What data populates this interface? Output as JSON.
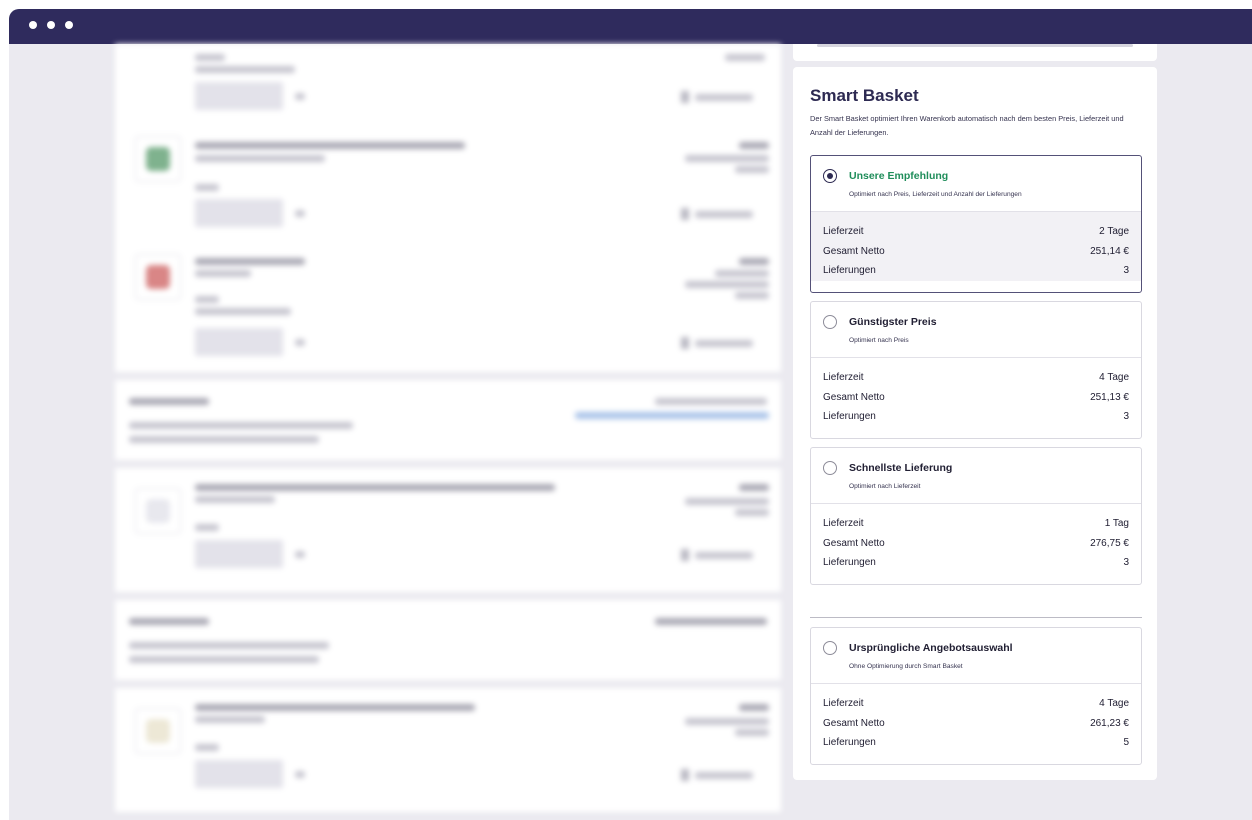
{
  "window": {
    "controls": [
      "dot",
      "dot",
      "dot"
    ]
  },
  "smart_basket": {
    "title": "Smart Basket",
    "description": "Der Smart Basket optimiert Ihren Warenkorb automatisch nach dem besten Preis, Lieferzeit und Anzahl der Lieferungen.",
    "labels": {
      "delivery_time": "Lieferzeit",
      "total_net": "Gesamt Netto",
      "deliveries": "Lieferungen"
    },
    "options": [
      {
        "name": "Unsere Empfehlung",
        "subtitle": "Optimiert nach Preis, Lieferzeit und Anzahl der Lieferungen",
        "delivery_time": "2 Tage",
        "total_net": "251,14 €",
        "deliveries": "3",
        "selected": true
      },
      {
        "name": "Günstigster Preis",
        "subtitle": "Optimiert nach Preis",
        "delivery_time": "4 Tage",
        "total_net": "251,13 €",
        "deliveries": "3",
        "selected": false
      },
      {
        "name": "Schnellste Lieferung",
        "subtitle": "Optimiert nach Lieferzeit",
        "delivery_time": "1 Tag",
        "total_net": "276,75 €",
        "deliveries": "3",
        "selected": false
      },
      {
        "name": "Ursprüngliche Angebotsauswahl",
        "subtitle": "Ohne Optimierung durch Smart Basket",
        "delivery_time": "4 Tage",
        "total_net": "261,23 €",
        "deliveries": "5",
        "selected": false
      }
    ]
  },
  "colors": {
    "titlebar": "#2f2b5d",
    "accent": "#2d2a52",
    "recommend_green": "#1f8d5a",
    "page_bg": "#ebeaf0"
  }
}
